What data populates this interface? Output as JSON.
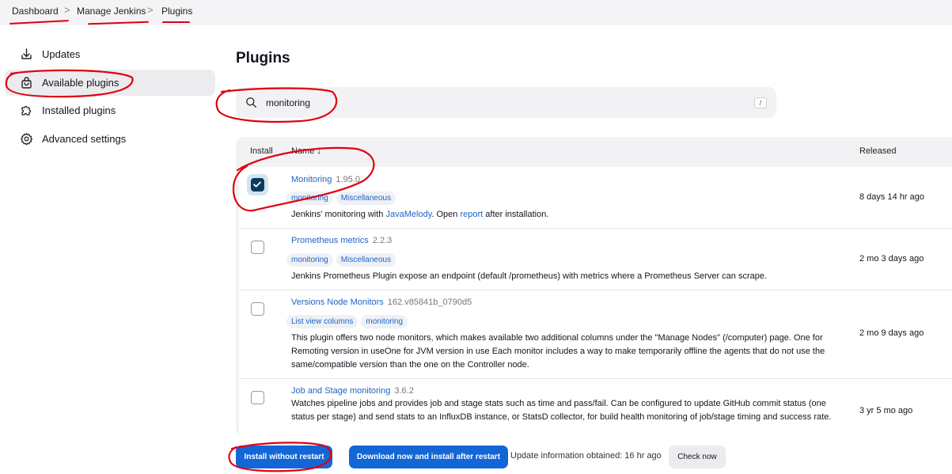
{
  "breadcrumb": {
    "items": [
      "Dashboard",
      "Manage Jenkins",
      "Plugins"
    ],
    "separator": ">"
  },
  "sidebar": {
    "items": [
      {
        "label": "Updates",
        "icon": "download-icon"
      },
      {
        "label": "Available plugins",
        "icon": "shopping-bag-icon",
        "active": true
      },
      {
        "label": "Installed plugins",
        "icon": "puzzle-icon"
      },
      {
        "label": "Advanced settings",
        "icon": "gear-icon"
      }
    ]
  },
  "main": {
    "title": "Plugins",
    "search": {
      "value": "monitoring",
      "shortcut": "/"
    },
    "table": {
      "headers": {
        "install": "Install",
        "name": "Name ↓",
        "released": "Released"
      },
      "rows": [
        {
          "name": "Monitoring",
          "version": "1.95.0",
          "tags": [
            "monitoring",
            "Miscellaneous"
          ],
          "desc_pre": "Jenkins' monitoring with ",
          "desc_link1": "JavaMelody",
          "desc_mid": ". Open ",
          "desc_link2": "report",
          "desc_post": " after installation.",
          "released": "8 days 14 hr ago",
          "checked": true
        },
        {
          "name": "Prometheus metrics",
          "version": "2.2.3",
          "tags": [
            "monitoring",
            "Miscellaneous"
          ],
          "desc": "Jenkins Prometheus Plugin expose an endpoint (default /prometheus) with metrics where a Prometheus Server can scrape.",
          "released": "2 mo 3 days ago",
          "checked": false
        },
        {
          "name": "Versions Node Monitors",
          "version": "162.v85841b_0790d5",
          "tags": [
            "List view columns",
            "monitoring"
          ],
          "desc": "This plugin offers two node monitors, which makes available two additional columns under the \"Manage Nodes\" (/computer) page. One for Remoting version in useOne for JVM version in use Each monitor includes a way to make temporarily offline the agents that do not use the same/compatible version than the one on the Controller node.",
          "released": "2 mo 9 days ago",
          "checked": false
        },
        {
          "name": "Job and Stage monitoring",
          "version": "3.6.2",
          "tags": [],
          "desc": "Watches pipeline jobs and provides job and stage stats such as time and pass/fail. Can be configured to update GitHub commit status (one status per stage) and send stats to an InfluxDB instance, or StatsD collector, for build health monitoring of job/stage timing and success rate.",
          "released": "3 yr 5 mo ago",
          "checked": false
        }
      ]
    }
  },
  "bottom": {
    "install_label": "Install without restart",
    "download_label": "Download now and install after restart",
    "update_info": "Update information obtained: 16 hr ago",
    "check_label": "Check now"
  },
  "colors": {
    "accent": "#1266d6",
    "link": "#1f63c6",
    "annotation": "#e0000f",
    "checkbox": "#0b3a5c"
  }
}
